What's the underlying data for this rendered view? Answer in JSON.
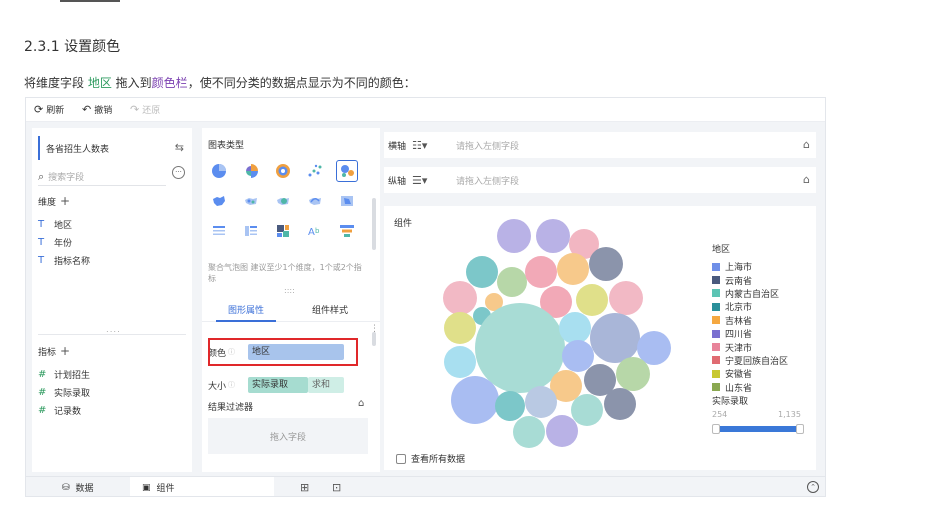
{
  "doc": {
    "heading": "2.3.1 设置颜色",
    "line_pre": "将维度字段 ",
    "line_field": "地区",
    "line_mid": " 拖入到",
    "line_target": "颜色栏",
    "line_post": "，使不同分类的数据点显示为不同的颜色："
  },
  "toolbar": {
    "refresh": "刷新",
    "undo": "撤销",
    "redo": "还原"
  },
  "left": {
    "dataset": "各省招生人数表",
    "search_placeholder": "搜索字段",
    "dim_title": "维度",
    "dims": [
      "地区",
      "年份",
      "指标名称"
    ],
    "measure_title": "指标",
    "measures": [
      "计划招生",
      "实际录取",
      "记录数"
    ]
  },
  "mid": {
    "chart_type_title": "图表类型",
    "tip": "聚合气泡图 建议至少1个维度，1个或2个指标",
    "tab_props": "图形属性",
    "tab_style": "组件样式",
    "color_label": "颜色",
    "color_field": "地区",
    "size_label": "大小",
    "size_field": "实际录取",
    "size_agg": "求和",
    "filter_title": "结果过滤器",
    "filter_drop": "拖入字段"
  },
  "axes": {
    "x_label": "横轴",
    "y_label": "纵轴",
    "placeholder": "请拖入左侧字段"
  },
  "canvas": {
    "title": "组件",
    "legend_title": "地区",
    "legend": [
      {
        "name": "上海市",
        "color": "#6f8fe8"
      },
      {
        "name": "云南省",
        "color": "#4a5a7e"
      },
      {
        "name": "内蒙古自治区",
        "color": "#5cc4b4"
      },
      {
        "name": "北京市",
        "color": "#2a8f9a"
      },
      {
        "name": "吉林省",
        "color": "#f5a840"
      },
      {
        "name": "四川省",
        "color": "#7a6fd0"
      },
      {
        "name": "天津市",
        "color": "#e8849a"
      },
      {
        "name": "宁夏回族自治区",
        "color": "#e06b72"
      },
      {
        "name": "安徽省",
        "color": "#c8c830"
      },
      {
        "name": "山东省",
        "color": "#8aa850"
      }
    ],
    "size_title": "实际录取",
    "size_min": "254",
    "size_max": "1,135",
    "show_all": "查看所有数据"
  },
  "bottom": {
    "data_tab": "数据",
    "component_tab": "组件"
  }
}
